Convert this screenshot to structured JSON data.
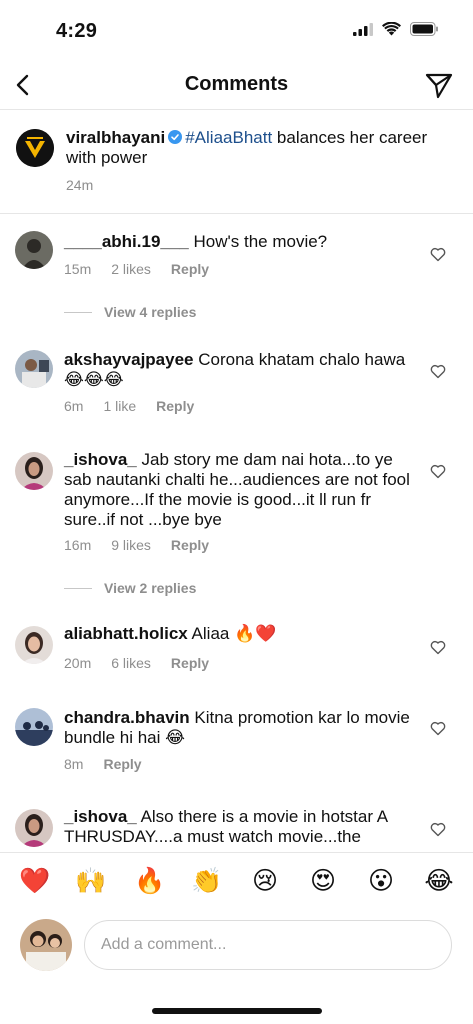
{
  "status": {
    "time": "4:29"
  },
  "header": {
    "title": "Comments"
  },
  "caption": {
    "username": "viralbhayani",
    "hashtag": "#AliaaBhatt",
    "text": "balances her career with power",
    "time": "24m"
  },
  "comments": [
    {
      "username": "____abhi.19___",
      "text": "How's the movie?",
      "time": "15m",
      "likes": "2 likes",
      "reply": "Reply",
      "view_replies": "View 4 replies"
    },
    {
      "username": "akshayvajpayee",
      "text": "Corona khatam chalo hawa 😂😂😂",
      "time": "6m",
      "likes": "1 like",
      "reply": "Reply"
    },
    {
      "username": "_ishova_",
      "text": "Jab story me dam nai hota...to ye sab nautanki chalti he...audiences are not fool anymore...If the movie is good...it ll run fr sure..if not ...bye bye",
      "time": "16m",
      "likes": "9 likes",
      "reply": "Reply",
      "view_replies": "View 2 replies"
    },
    {
      "username": "aliabhatt.holicx",
      "text": "Aliaa 🔥❤️",
      "time": "20m",
      "likes": "6 likes",
      "reply": "Reply"
    },
    {
      "username": "chandra.bhavin",
      "text": "Kitna promotion kar lo movie bundle hi hai 😂",
      "time": "8m",
      "reply": "Reply"
    },
    {
      "username": "_ishova_",
      "text": "Also there is a movie in hotstar A THRUSDAY....a must watch movie...the"
    }
  ],
  "emoji_bar": [
    "❤️",
    "🙌",
    "🔥",
    "👏",
    "😢",
    "😍",
    "😮",
    "😂"
  ],
  "input": {
    "placeholder": "Add a comment..."
  }
}
